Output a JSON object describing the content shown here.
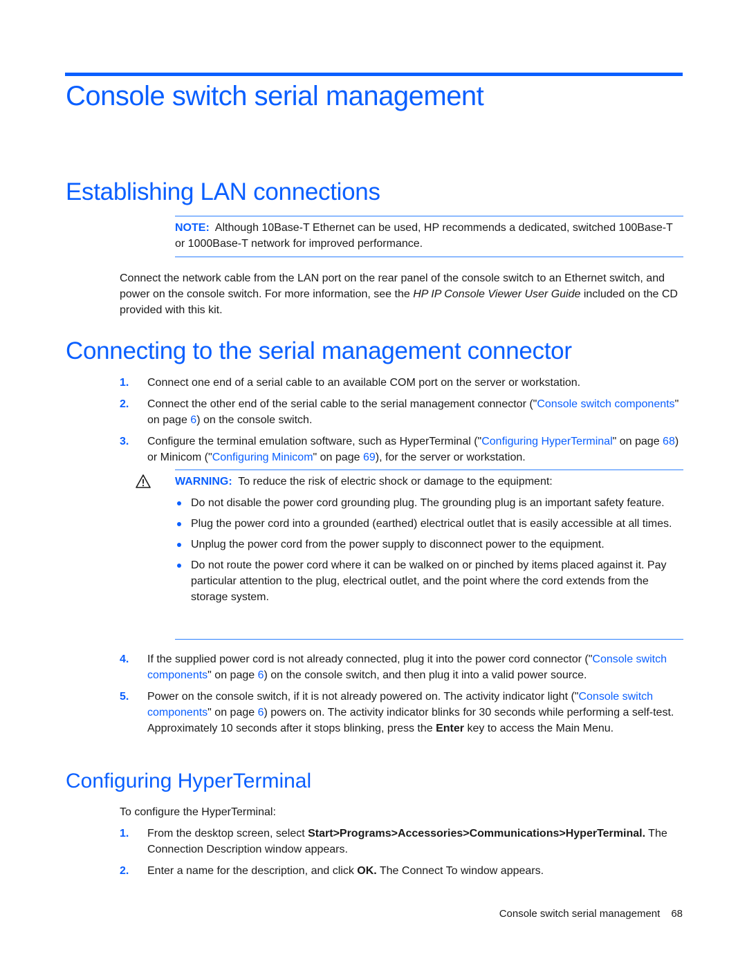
{
  "colors": {
    "accent": "#0a5fff",
    "text": "#1a1a1a"
  },
  "chapter_title": "Console switch serial management",
  "sections": {
    "lan": {
      "title": "Establishing LAN connections",
      "note_label": "NOTE:",
      "note_text": "Although 10Base-T Ethernet can be used, HP recommends a dedicated, switched 100Base-T or 1000Base-T network for improved performance.",
      "para_before": "Connect the network cable from the LAN port on the rear panel of the console switch to an Ethernet switch, and power on the console switch. For more information, see the ",
      "para_italic": "HP IP Console Viewer User Guide",
      "para_after": " included on the CD provided with this kit."
    },
    "serial": {
      "title": "Connecting to the serial management connector",
      "steps": [
        {
          "num": "1.",
          "text": "Connect one end of a serial cable to an available COM port on the server or workstation."
        },
        {
          "num": "2.",
          "pre": "Connect the other end of the serial cable to the serial management connector (\"",
          "link": "Console switch components",
          "mid": "\" on page ",
          "page": "6",
          "post": ") on the console switch."
        },
        {
          "num": "3.",
          "pre": "Configure the terminal emulation software, such as HyperTerminal (\"",
          "link": "Configuring HyperTerminal",
          "mid": "\" on page ",
          "page": "68",
          "mid2": ") or Minicom (\"",
          "link2": "Configuring Minicom",
          "mid3": "\" on page ",
          "page2": "69",
          "post": "), for the server or workstation."
        },
        {
          "num": "4.",
          "pre": "If the supplied power cord is not already connected, plug it into the power cord connector (\"",
          "link": "Console switch components",
          "mid": "\" on page ",
          "page": "6",
          "post": ") on the console switch, and then plug it into a valid power source."
        },
        {
          "num": "5.",
          "pre": "Power on the console switch, if it is not already powered on. The activity indicator light (\"",
          "link": "Console switch components",
          "mid": "\" on page ",
          "page": "6",
          "post": ") powers on. The activity indicator blinks for 30 seconds while performing a self-test. Approximately 10 seconds after it stops blinking, press the ",
          "bold": "Enter",
          "post2": " key to access the Main Menu."
        }
      ],
      "warning": {
        "icon": "warning-triangle-icon",
        "label": "WARNING:",
        "text": "To reduce the risk of electric shock or damage to the equipment:",
        "bullets": [
          "Do not disable the power cord grounding plug. The grounding plug is an important safety feature.",
          "Plug the power cord into a grounded (earthed) electrical outlet that is easily accessible at all times.",
          "Unplug the power cord from the power supply to disconnect power to the equipment.",
          "Do not route the power cord where it can be walked on or pinched by items placed against it. Pay particular attention to the plug, electrical outlet, and the point where the cord extends from the storage system."
        ]
      }
    },
    "hyperterminal": {
      "title": "Configuring HyperTerminal",
      "intro": "To configure the HyperTerminal:",
      "steps": [
        {
          "num": "1.",
          "pre": "From the desktop screen, select ",
          "bold": "Start>Programs>Accessories>Communications>HyperTerminal.",
          "post": " The Connection Description window appears."
        },
        {
          "num": "2.",
          "pre": "Enter a name for the description, and click ",
          "bold": "OK.",
          "post": " The Connect To window appears."
        }
      ]
    }
  },
  "footer": {
    "title": "Console switch serial management",
    "page": "68"
  }
}
